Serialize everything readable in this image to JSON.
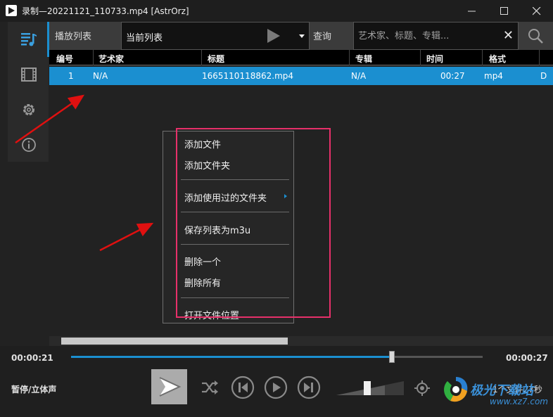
{
  "window": {
    "title": "录制—20221121_110733.mp4 [AstrOrz]",
    "minimize_icon": "minimize-icon",
    "maximize_icon": "maximize-icon",
    "close_icon": "close-icon"
  },
  "sidebar": {
    "items": [
      {
        "icon": "playlist-icon",
        "active": true
      },
      {
        "icon": "film-icon",
        "active": false
      },
      {
        "icon": "gear-icon",
        "active": false
      },
      {
        "icon": "info-icon",
        "active": false
      }
    ]
  },
  "toolbar": {
    "playlist_tab": "播放列表",
    "selected_list": "当前列表",
    "query_label": "查询",
    "search_placeholder": "艺术家、标题、专辑...",
    "clear_symbol": "✕"
  },
  "table": {
    "columns": [
      "编号",
      "艺术家",
      "标题",
      "专辑",
      "时间",
      "格式"
    ],
    "rows": [
      {
        "no": "1",
        "artist": "N/A",
        "title": "1665110118862.mp4",
        "album": "N/A",
        "time": "00:27",
        "format": "mp4",
        "extra": "D"
      }
    ]
  },
  "context_menu": {
    "items": [
      "添加文件",
      "添加文件夹",
      "添加使用过的文件夹",
      "保存列表为m3u",
      "删除一个",
      "删除所有",
      "打开文件位置"
    ]
  },
  "player": {
    "current_time": "00:00:21",
    "total_time": "00:00:27",
    "progress_fraction": 0.78,
    "status": "暂停/立体声",
    "volume_fraction": 0.72,
    "file_count": "1个文件27秒"
  },
  "watermark": {
    "line1": "极光下载站",
    "line2": "www.xz7.com"
  },
  "colors": {
    "accent": "#1b8fd0",
    "highlight_box": "#e7306a",
    "arrow": "#e01010"
  }
}
